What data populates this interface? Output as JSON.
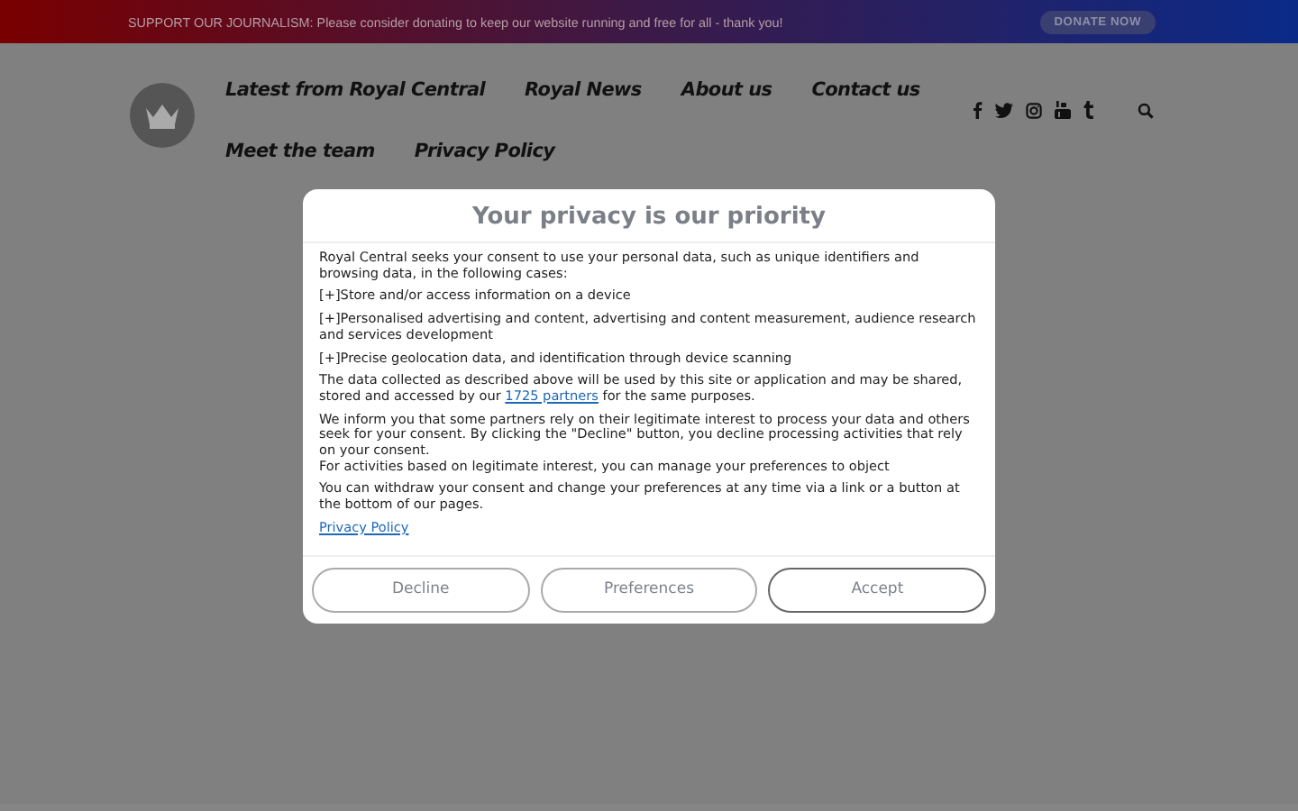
{
  "top_bar": {
    "message": "SUPPORT OUR JOURNALISM: Please consider donating to keep our website running and free for all - thank you!",
    "button": "DONATE NOW"
  },
  "nav": {
    "items": [
      "Latest from Royal Central",
      "Royal News",
      "About us",
      "Contact us",
      "Meet the team",
      "Privacy Policy"
    ],
    "social": [
      {
        "kind": "facebook"
      },
      {
        "kind": "twitter"
      },
      {
        "kind": "instagram"
      },
      {
        "kind": "youtube"
      },
      {
        "kind": "tumblr"
      }
    ]
  },
  "consent": {
    "title": "Your privacy is our priority",
    "blocks": [
      {
        "kind": "para",
        "text": "Royal Central seeks your consent to use your personal data, such as unique identifiers and browsing data, in the following cases:"
      },
      {
        "kind": "purpose",
        "toggle": "[+]",
        "text": "Store and/or access information on a device"
      },
      {
        "kind": "purpose",
        "toggle": "[+]",
        "text": "Personalised advertising and content, advertising and content measurement, audience research and services development"
      },
      {
        "kind": "purpose",
        "toggle": "[+]",
        "text": "Precise geolocation data, and identification through device scanning"
      },
      {
        "kind": "link_para",
        "before": "The data collected as described above will be used by this site or application and may be shared, stored and accessed by our ",
        "link": "1725 partners",
        "after": " for the same purposes."
      },
      {
        "kind": "para",
        "text": "We inform you that some partners rely on their legitimate interest to process your data and others seek for your consent. By clicking the \"Decline\" button, you decline processing activities that rely on your consent."
      },
      {
        "kind": "tight_para",
        "text": "For activities based on legitimate interest, you can manage your preferences to object"
      },
      {
        "kind": "para",
        "text": "You can withdraw your consent and change your preferences at any time via a link or a button at the bottom of our pages."
      },
      {
        "kind": "link",
        "text": "Privacy Policy"
      }
    ],
    "buttons": [
      {
        "label": "Decline",
        "kind": "secondary"
      },
      {
        "label": "Preferences",
        "kind": "secondary"
      },
      {
        "label": "Accept",
        "kind": "primary"
      }
    ]
  }
}
